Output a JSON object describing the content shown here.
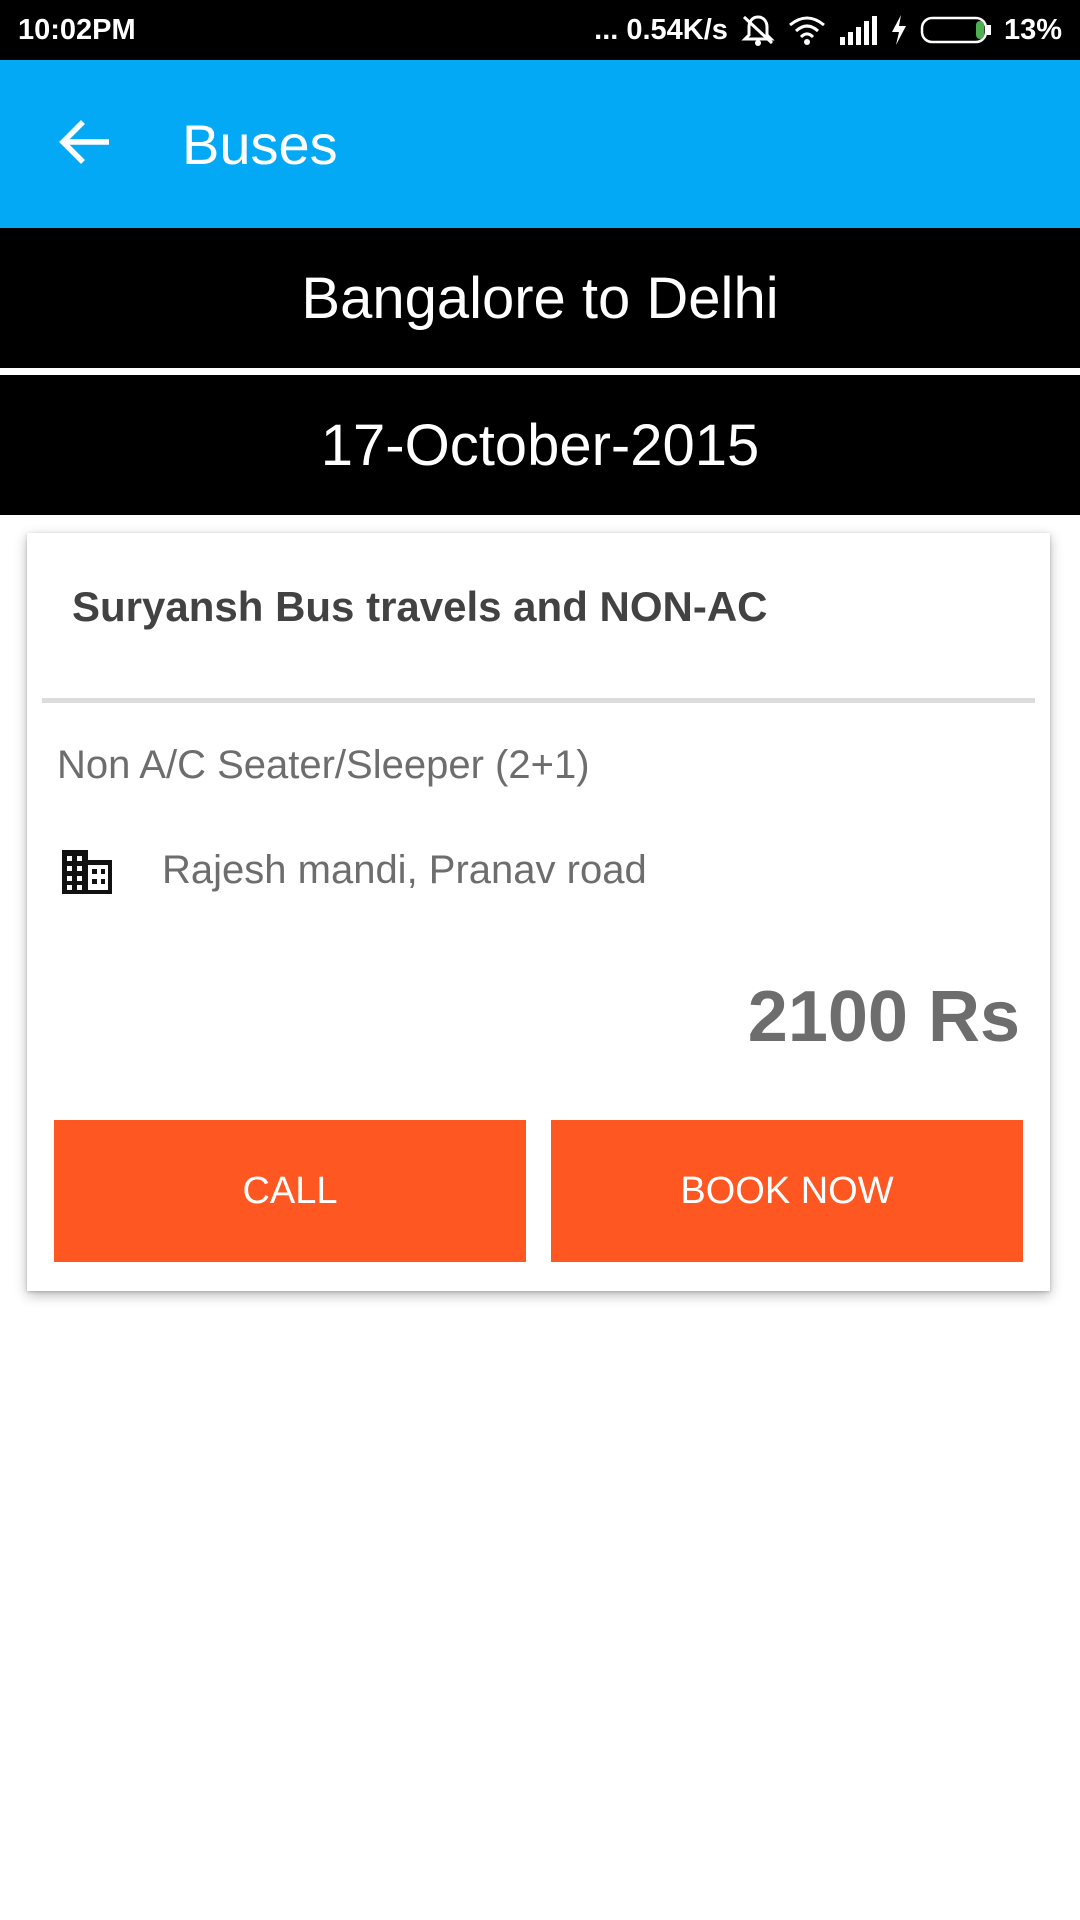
{
  "status_bar": {
    "time": "10:02PM",
    "network_speed": "... 0.54K/s",
    "battery_percent": "13%",
    "icons": [
      "mute-icon",
      "wifi-icon",
      "signal-icon",
      "charging-icon",
      "battery-icon"
    ]
  },
  "app_bar": {
    "title": "Buses",
    "back_icon": "arrow-back-icon",
    "background_color": "#03a9f4"
  },
  "route": {
    "label": "Bangalore to Delhi"
  },
  "date": {
    "label": "17-October-2015"
  },
  "bus_card": {
    "operator": "Suryansh Bus travels and NON-AC",
    "bus_type": "Non A/C Seater/Sleeper (2+1)",
    "location_icon": "building-icon",
    "location": "Rajesh mandi, Pranav road",
    "price": "2100 Rs",
    "call_label": "CALL",
    "book_label": "BOOK NOW",
    "button_color": "#ff5722"
  }
}
